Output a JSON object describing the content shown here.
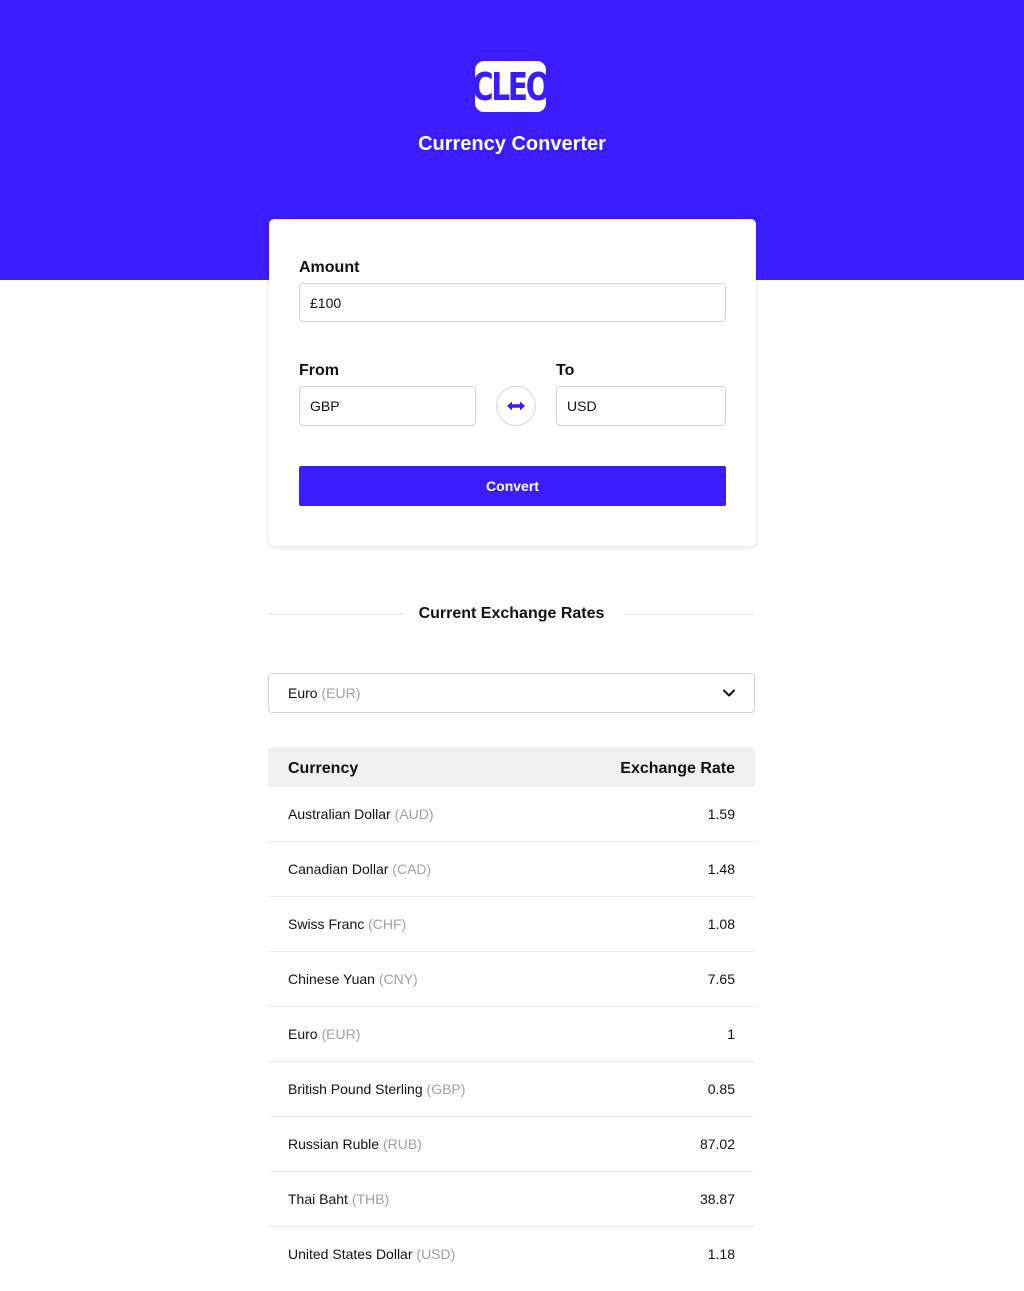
{
  "header": {
    "logo_text": "CLEO",
    "title": "Currency Converter",
    "background": "#3a1cff"
  },
  "converter": {
    "amount_label": "Amount",
    "amount_value": "£100",
    "from_label": "From",
    "from_value": "GBP",
    "to_label": "To",
    "to_value": "USD",
    "swap_icon": "swap-horizontal-icon",
    "convert_label": "Convert"
  },
  "rates": {
    "heading": "Current Exchange Rates",
    "base_select": {
      "name": "Euro",
      "code": "(EUR)"
    },
    "columns": [
      "Currency",
      "Exchange Rate"
    ],
    "rows": [
      {
        "name": "Australian Dollar",
        "code": "(AUD)",
        "rate": "1.59"
      },
      {
        "name": "Canadian Dollar",
        "code": "(CAD)",
        "rate": "1.48"
      },
      {
        "name": "Swiss Franc",
        "code": "(CHF)",
        "rate": "1.08"
      },
      {
        "name": "Chinese Yuan",
        "code": "(CNY)",
        "rate": "7.65"
      },
      {
        "name": "Euro",
        "code": "(EUR)",
        "rate": "1"
      },
      {
        "name": "British Pound Sterling",
        "code": "(GBP)",
        "rate": "0.85"
      },
      {
        "name": "Russian Ruble",
        "code": "(RUB)",
        "rate": "87.02"
      },
      {
        "name": "Thai Baht",
        "code": "(THB)",
        "rate": "38.87"
      },
      {
        "name": "United States Dollar",
        "code": "(USD)",
        "rate": "1.18"
      }
    ]
  }
}
